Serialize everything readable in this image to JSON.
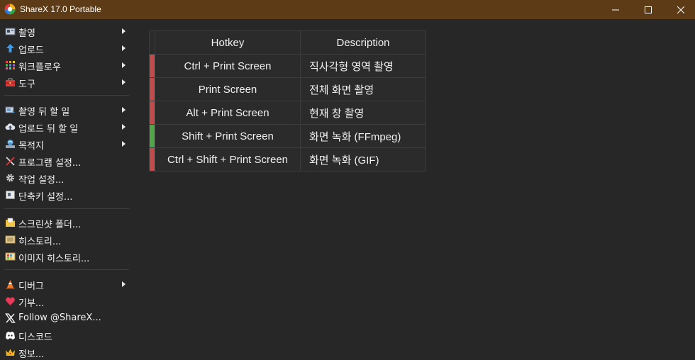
{
  "window": {
    "title": "ShareX 17.0 Portable"
  },
  "menu": {
    "items": [
      {
        "label": "촬영",
        "icon": "camera-icon",
        "arrow": true
      },
      {
        "label": "업로드",
        "icon": "upload-arrow-icon",
        "arrow": true
      },
      {
        "label": "워크플로우",
        "icon": "workflow-grid-icon",
        "arrow": true
      },
      {
        "label": "도구",
        "icon": "toolbox-icon",
        "arrow": true
      },
      {
        "label": "촬영 뒤 할 일",
        "icon": "after-capture-icon",
        "arrow": true
      },
      {
        "label": "업로드 뒤 할 일",
        "icon": "cloud-upload-icon",
        "arrow": true
      },
      {
        "label": "목적지",
        "icon": "destination-icon",
        "arrow": true
      },
      {
        "label": "프로그램 설정...",
        "icon": "tools-icon",
        "arrow": false
      },
      {
        "label": "작업 설정...",
        "icon": "gear-icon",
        "arrow": false
      },
      {
        "label": "단축키 설정...",
        "icon": "keyboard-icon",
        "arrow": false
      },
      {
        "label": "스크린샷 폴더...",
        "icon": "folder-icon",
        "arrow": false
      },
      {
        "label": "히스토리...",
        "icon": "history-icon",
        "arrow": false
      },
      {
        "label": "이미지 히스토리...",
        "icon": "image-history-icon",
        "arrow": false
      },
      {
        "label": "디버그",
        "icon": "cone-icon",
        "arrow": true
      },
      {
        "label": "기부...",
        "icon": "heart-icon",
        "arrow": false
      },
      {
        "label": "Follow @ShareX...",
        "icon": "x-logo-icon",
        "arrow": false
      },
      {
        "label": "디스코드",
        "icon": "discord-icon",
        "arrow": false
      },
      {
        "label": "정보...",
        "icon": "crown-icon",
        "arrow": false
      }
    ]
  },
  "hotkeys": {
    "headers": {
      "hotkey": "Hotkey",
      "description": "Description"
    },
    "rows": [
      {
        "hotkey": "Ctrl + Print Screen",
        "description": "직사각형 영역 촬영",
        "status": "red"
      },
      {
        "hotkey": "Print Screen",
        "description": "전체 화면 촬영",
        "status": "red"
      },
      {
        "hotkey": "Alt + Print Screen",
        "description": "현재 창 촬영",
        "status": "red"
      },
      {
        "hotkey": "Shift + Print Screen",
        "description": "화면 녹화 (FFmpeg)",
        "status": "green"
      },
      {
        "hotkey": "Ctrl + Shift + Print Screen",
        "description": "화면 녹화 (GIF)",
        "status": "red"
      }
    ]
  },
  "colors": {
    "titlebar": "#5c3b16",
    "background": "#272727",
    "status_red": "#c24b4b",
    "status_green": "#52a64a"
  }
}
